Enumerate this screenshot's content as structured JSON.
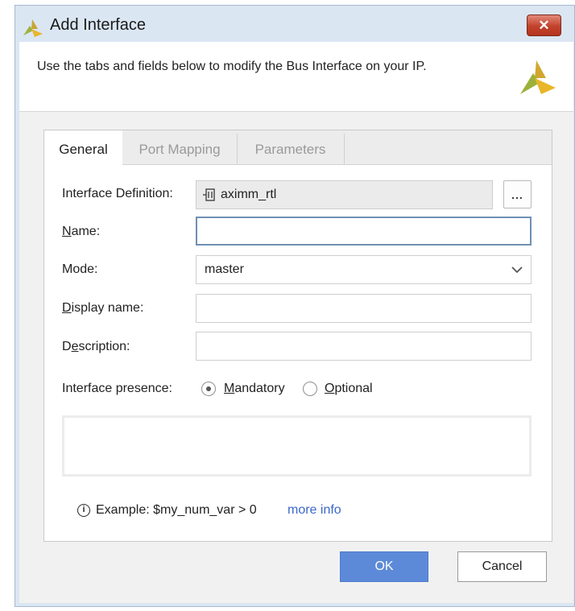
{
  "window": {
    "title": "Add Interface",
    "close_symbol": "✕",
    "icons": {
      "title": "vivado-logo-icon",
      "header": "vivado-logo-icon",
      "close": "close-icon"
    }
  },
  "header": {
    "description": "Use the tabs and fields below to modify the Bus Interface on your IP."
  },
  "tabs": [
    {
      "label": "General",
      "selected": true
    },
    {
      "label": "Port Mapping",
      "selected": false
    },
    {
      "label": "Parameters",
      "selected": false
    }
  ],
  "form": {
    "interface_definition": {
      "label": "Interface Definition:",
      "value": "aximm_rtl",
      "browse_label": "..."
    },
    "name": {
      "label": "Name:",
      "value": ""
    },
    "mode": {
      "label": "Mode:",
      "value": "master"
    },
    "display_name": {
      "label": "Display name:",
      "value": ""
    },
    "description": {
      "label": "Description:",
      "value": ""
    },
    "presence": {
      "label": "Interface presence:",
      "options": [
        {
          "label": "Mandatory",
          "checked": true
        },
        {
          "label": "Optional",
          "checked": false
        }
      ]
    }
  },
  "example": {
    "text": "Example:  $my_num_var > 0",
    "link": "more info"
  },
  "buttons": {
    "ok": "OK",
    "cancel": "Cancel"
  },
  "colors": {
    "accent": "#5d8ad8",
    "link": "#3b67c9",
    "close": "#c2422c"
  }
}
